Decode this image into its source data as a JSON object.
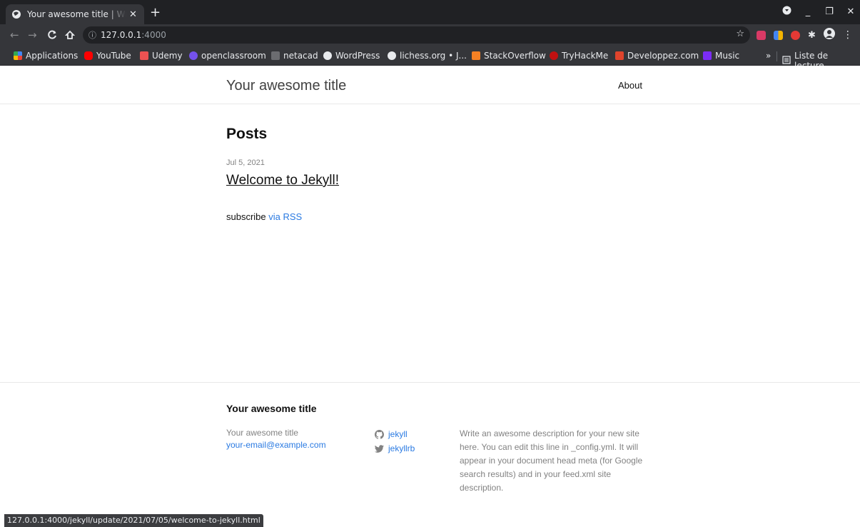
{
  "browser": {
    "tab": {
      "title": "Your awesome title | Write an awesome description"
    },
    "address": {
      "host": "127.0.0.1",
      "port": ":4000"
    },
    "bookmarks": [
      {
        "label": "Applications",
        "color": "#f4b400"
      },
      {
        "label": "YouTube",
        "color": "#ff0000"
      },
      {
        "label": "Udemy",
        "color": "#ec5252"
      },
      {
        "label": "openclassroom",
        "color": "#7451eb"
      },
      {
        "label": "netacad",
        "color": "#9aa0a6"
      },
      {
        "label": "WordPress",
        "color": "#e8eaed"
      },
      {
        "label": "lichess.org • J...",
        "color": "#e8eaed"
      },
      {
        "label": "StackOverflow",
        "color": "#f48024"
      },
      {
        "label": "TryHackMe",
        "color": "#c11111"
      },
      {
        "label": "Developpez.com",
        "color": "#e0442c"
      },
      {
        "label": "Music",
        "color": "#7b2cf5"
      }
    ],
    "bookmarks_more": "»",
    "reading_list": "Liste de lecture",
    "status_url": "127.0.0.1:4000/jekyll/update/2021/07/05/welcome-to-jekyll.html"
  },
  "site": {
    "title": "Your awesome title",
    "nav": {
      "about": "About"
    },
    "posts_heading": "Posts",
    "posts": [
      {
        "date": "Jul 5, 2021",
        "title": "Welcome to Jekyll!"
      }
    ],
    "subscribe": {
      "text": "subscribe",
      "link": "via RSS"
    },
    "footer": {
      "title": "Your awesome title",
      "name": "Your awesome title",
      "email": "your-email@example.com",
      "social": {
        "github": "jekyll",
        "twitter": "jekyllrb"
      },
      "description": "Write an awesome description for your new site here. You can edit this line in _config.yml. It will appear in your document head meta (for Google search results) and in your feed.xml site description."
    },
    "link_color": "#2a7ae2"
  }
}
